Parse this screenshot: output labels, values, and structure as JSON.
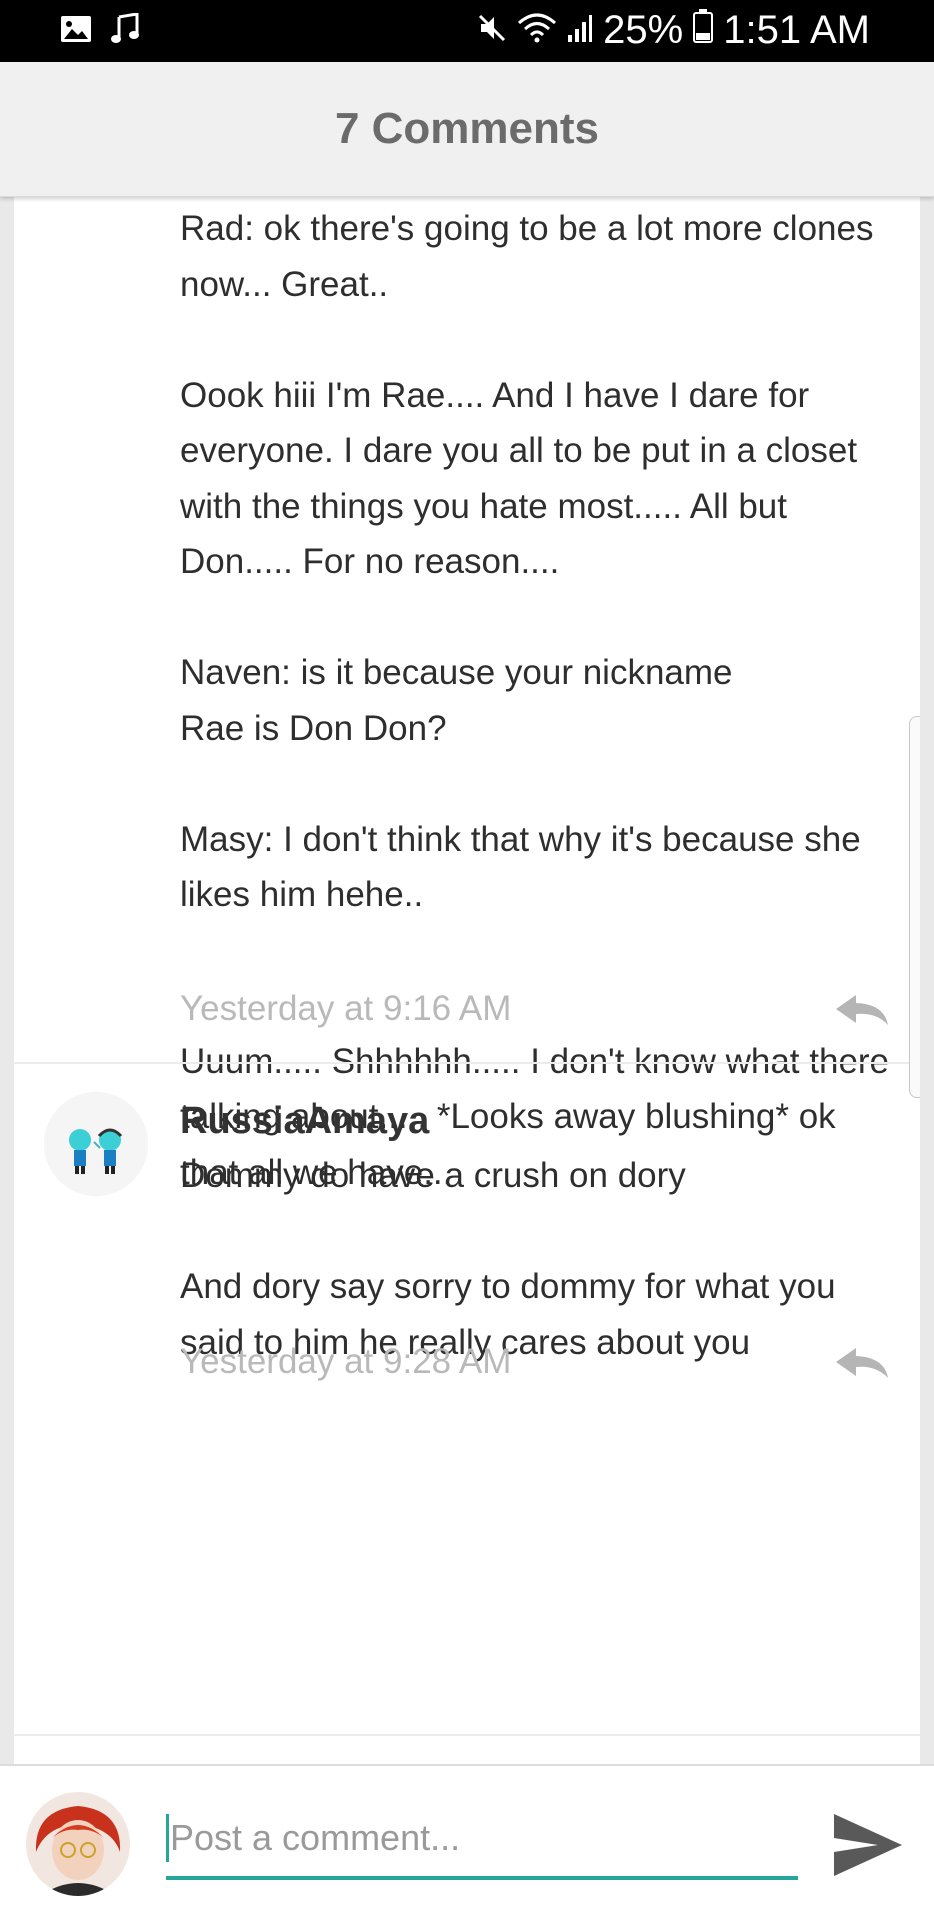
{
  "status_bar": {
    "left_icons": [
      "image-icon",
      "music-note-icon"
    ],
    "right_icons": [
      "mute-icon",
      "wifi-icon",
      "signal-icon",
      "battery-icon"
    ],
    "battery": "25%",
    "time": "1:51 AM"
  },
  "header": {
    "title": "7 Comments"
  },
  "comments": [
    {
      "paragraphs": [
        "Rad: ok there's going to be a lot more clones now... Great..",
        "Oook hiii I'm Rae.... And I have I dare for everyone. I dare you all to be put in a closet with the things you hate most..... All but Don..... For no reason....",
        "Naven: is it because your nickname Rae is Don Don?",
        "Masy: I don't think that why it's because she likes him hehe..",
        "Uuum..... Shhhhhh..... I don't know what there talking about..... *Looks away blushing* ok that all we have..."
      ],
      "timestamp": "Yesterday at 9:16 AM"
    },
    {
      "username": "RussiaAmaya",
      "paragraphs": [
        "Dommy do have a crush on dory",
        "And dory say sorry to dommy for what you said to him he really cares about you"
      ],
      "timestamp": "Yesterday at 9:28 AM"
    }
  ],
  "composer": {
    "placeholder": "Post a comment..."
  },
  "colors": {
    "accent": "#26a69a",
    "header_bg": "#f0f0f0",
    "timestamp": "#b9b9b9"
  }
}
